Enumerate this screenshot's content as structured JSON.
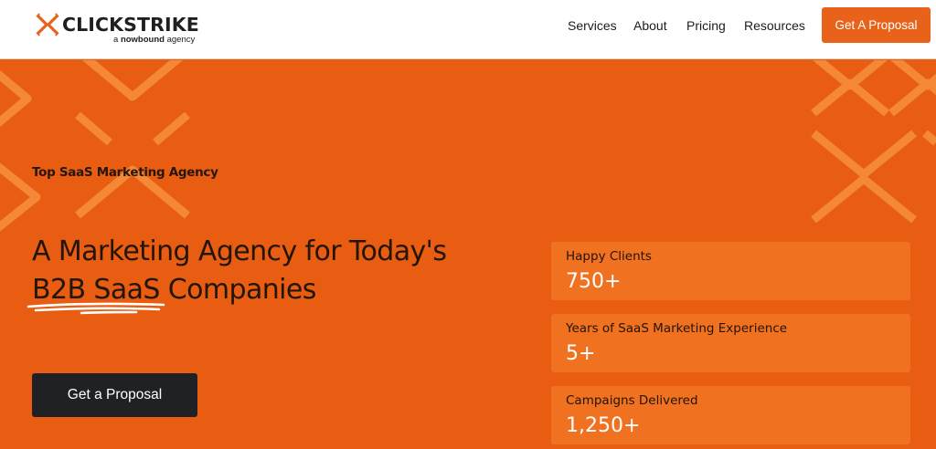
{
  "brand": {
    "name": "CLICKSTRIKE",
    "tagline_prefix": "a",
    "tagline_brand": "nowbound",
    "tagline_suffix": "agency",
    "accent_color": "#e85d12",
    "logo_icon": "x-mark-icon"
  },
  "nav": {
    "items": [
      {
        "label": "Services"
      },
      {
        "label": "About"
      },
      {
        "label": "Pricing"
      },
      {
        "label": "Resources"
      }
    ],
    "cta_label": "Get A Proposal"
  },
  "hero": {
    "eyebrow": "Top SaaS Marketing Agency",
    "headline_line1": "A Marketing Agency for Today's",
    "headline_highlight": "B2B SaaS",
    "headline_line2_rest": " Companies",
    "cta_label": "Get a Proposal",
    "background_color": "#e85d12",
    "button_color": "#1f2125"
  },
  "stats": [
    {
      "label": "Happy Clients",
      "value": "750+"
    },
    {
      "label": "Years of SaaS Marketing Experience",
      "value": "5+"
    },
    {
      "label": "Campaigns Delivered",
      "value": "1,250+"
    }
  ]
}
